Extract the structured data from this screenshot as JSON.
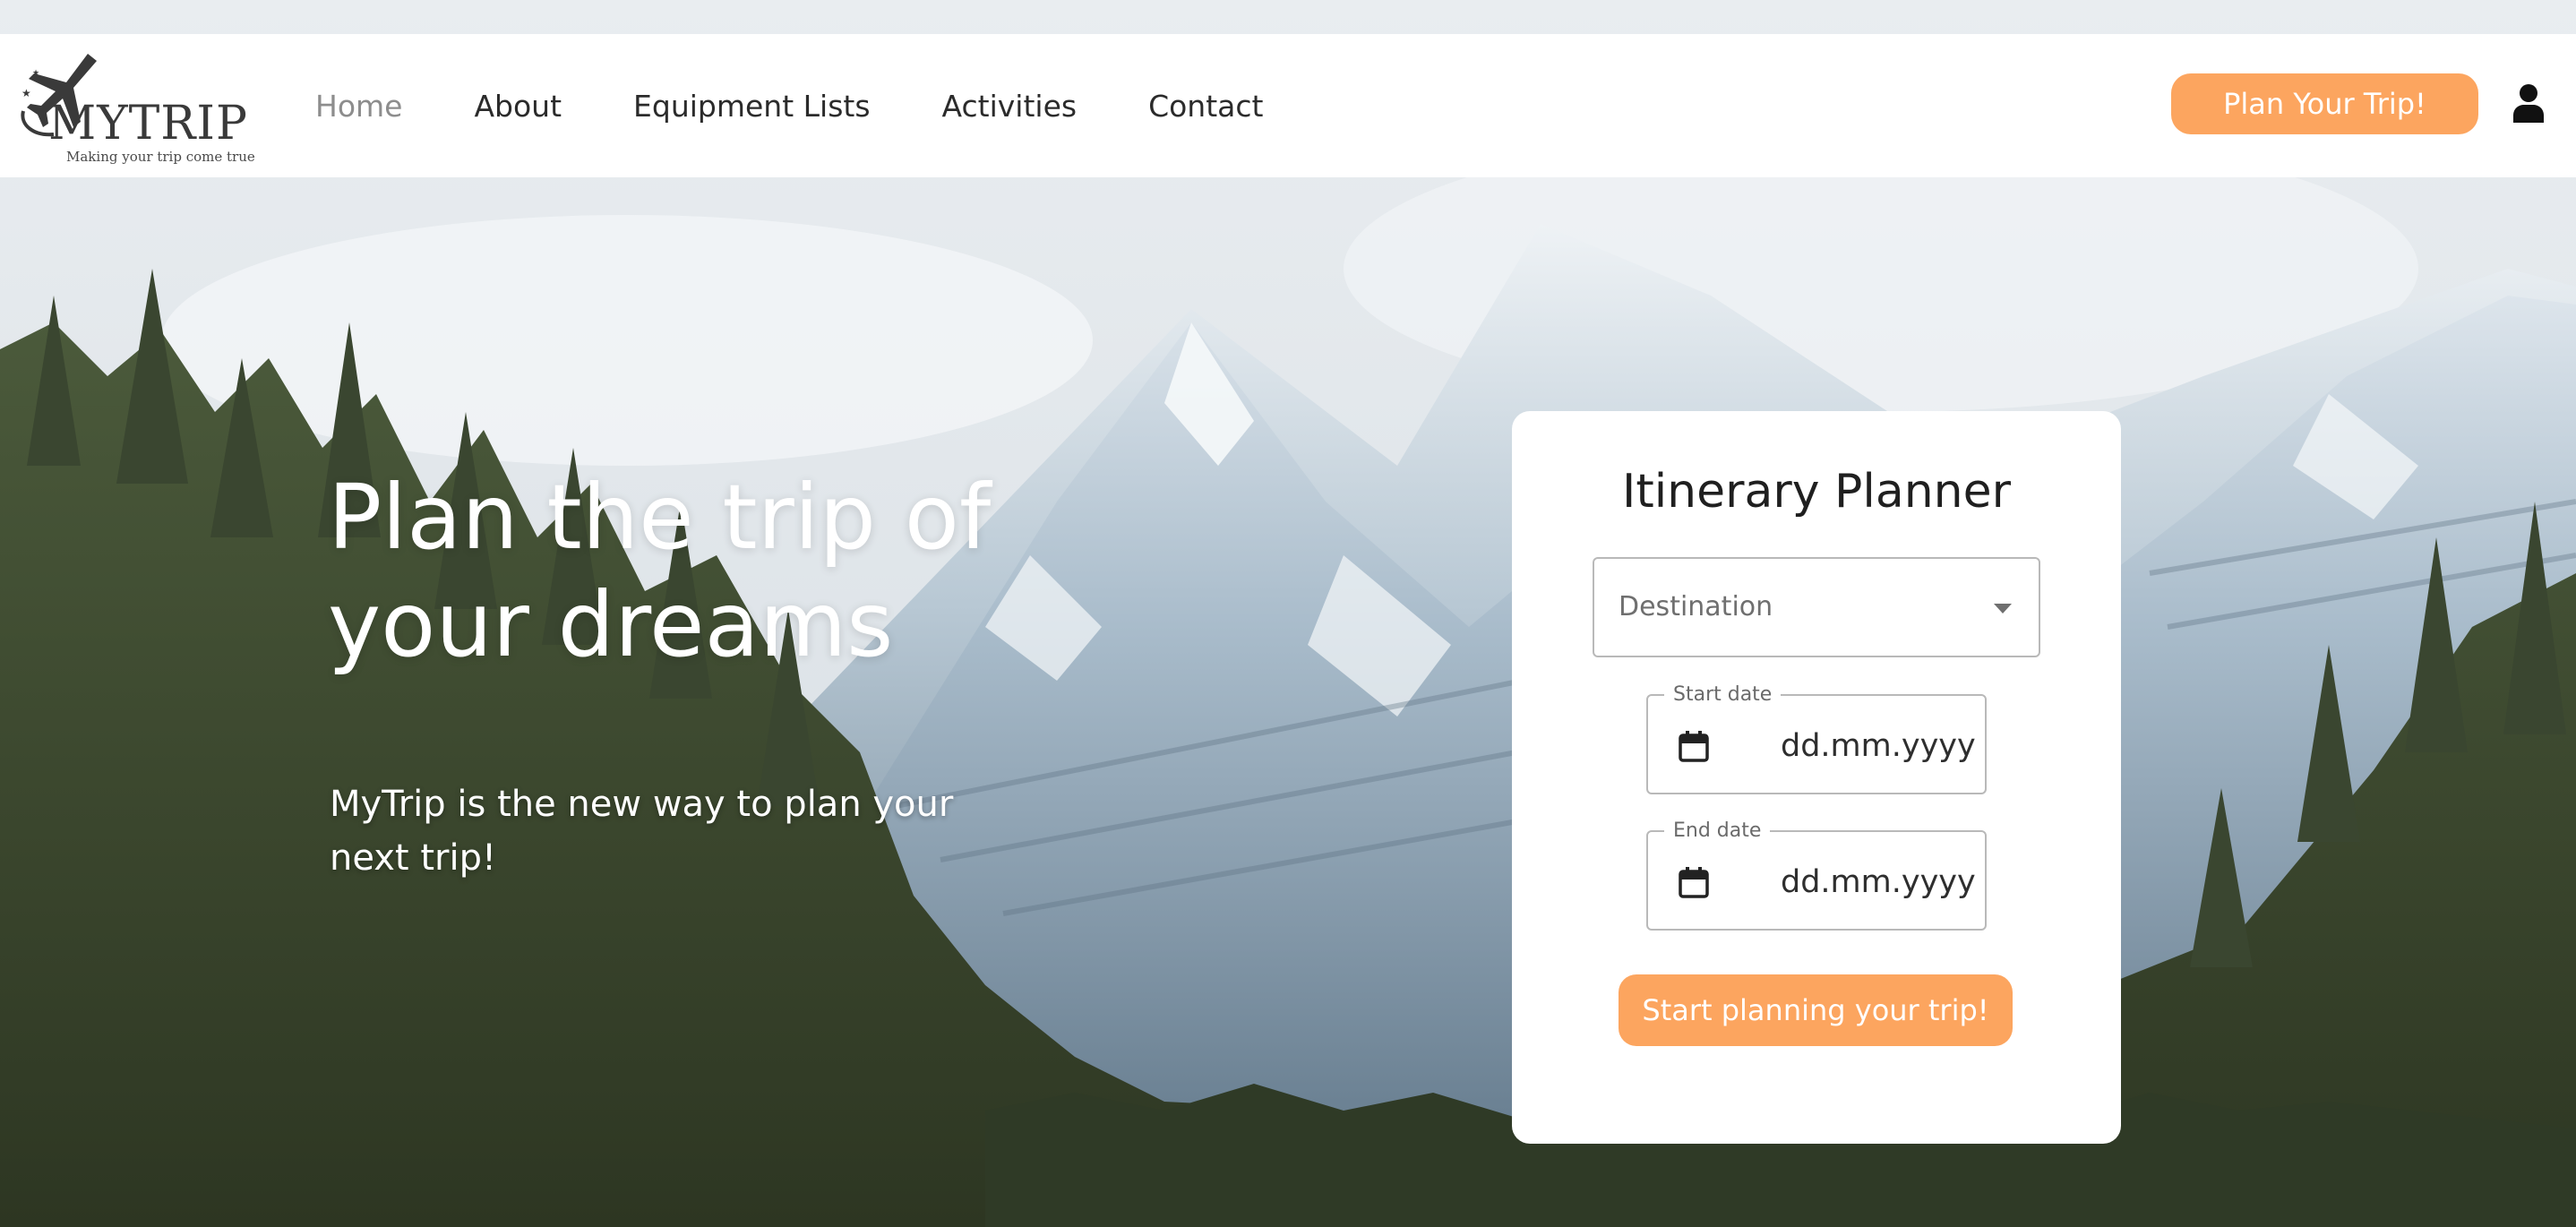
{
  "brand": {
    "name": "MYTRIP",
    "tagline": "Making your trip come true"
  },
  "nav": {
    "items": [
      {
        "label": "Home",
        "active": true
      },
      {
        "label": "About",
        "active": false
      },
      {
        "label": "Equipment Lists",
        "active": false
      },
      {
        "label": "Activities",
        "active": false
      },
      {
        "label": "Contact",
        "active": false
      }
    ],
    "cta_label": "Plan Your Trip!",
    "user_icon": "user-icon"
  },
  "hero": {
    "title_line1": "Plan the trip of",
    "title_line2": "your dreams",
    "subtitle_line1": "MyTrip is the new way to plan your",
    "subtitle_line2": "next trip!"
  },
  "planner": {
    "title": "Itinerary Planner",
    "destination": {
      "placeholder": "Destination",
      "icon": "caret-down-icon"
    },
    "start_date": {
      "label": "Start date",
      "value": "dd.mm.yyyy",
      "icon": "calendar-icon"
    },
    "end_date": {
      "label": "End date",
      "value": "dd.mm.yyyy",
      "icon": "calendar-icon"
    },
    "submit_label": "Start planning your trip!"
  },
  "colors": {
    "accent": "#fca55f",
    "nav_active": "#8d8d8d",
    "text_dark": "#2b2b2b",
    "card_bg": "#ffffff"
  }
}
